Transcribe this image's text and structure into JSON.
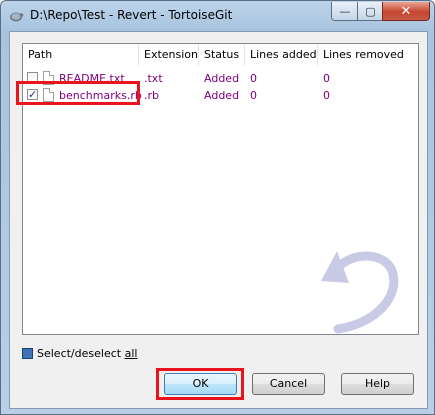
{
  "window": {
    "title": "D:\\Repo\\Test - Revert - TortoiseGit"
  },
  "title_buttons": {
    "minimize": "—",
    "maximize": "▢",
    "close": "✕"
  },
  "list": {
    "columns": [
      "Path",
      "Extension",
      "Status",
      "Lines added",
      "Lines removed"
    ],
    "rows": [
      {
        "path": "README.txt",
        "extension": ".txt",
        "status": "Added",
        "lines_added": "0",
        "lines_removed": "0",
        "checked": false
      },
      {
        "path": "benchmarks.rb",
        "extension": ".rb",
        "status": "Added",
        "lines_added": "0",
        "lines_removed": "0",
        "checked": true
      }
    ]
  },
  "select_all": {
    "label_prefix": "Select/deselect ",
    "label_accel": "all"
  },
  "buttons": {
    "ok": "OK",
    "cancel": "Cancel",
    "help": "Help"
  },
  "colors": {
    "entry_text": "#800080",
    "highlight": "#e8131b"
  }
}
